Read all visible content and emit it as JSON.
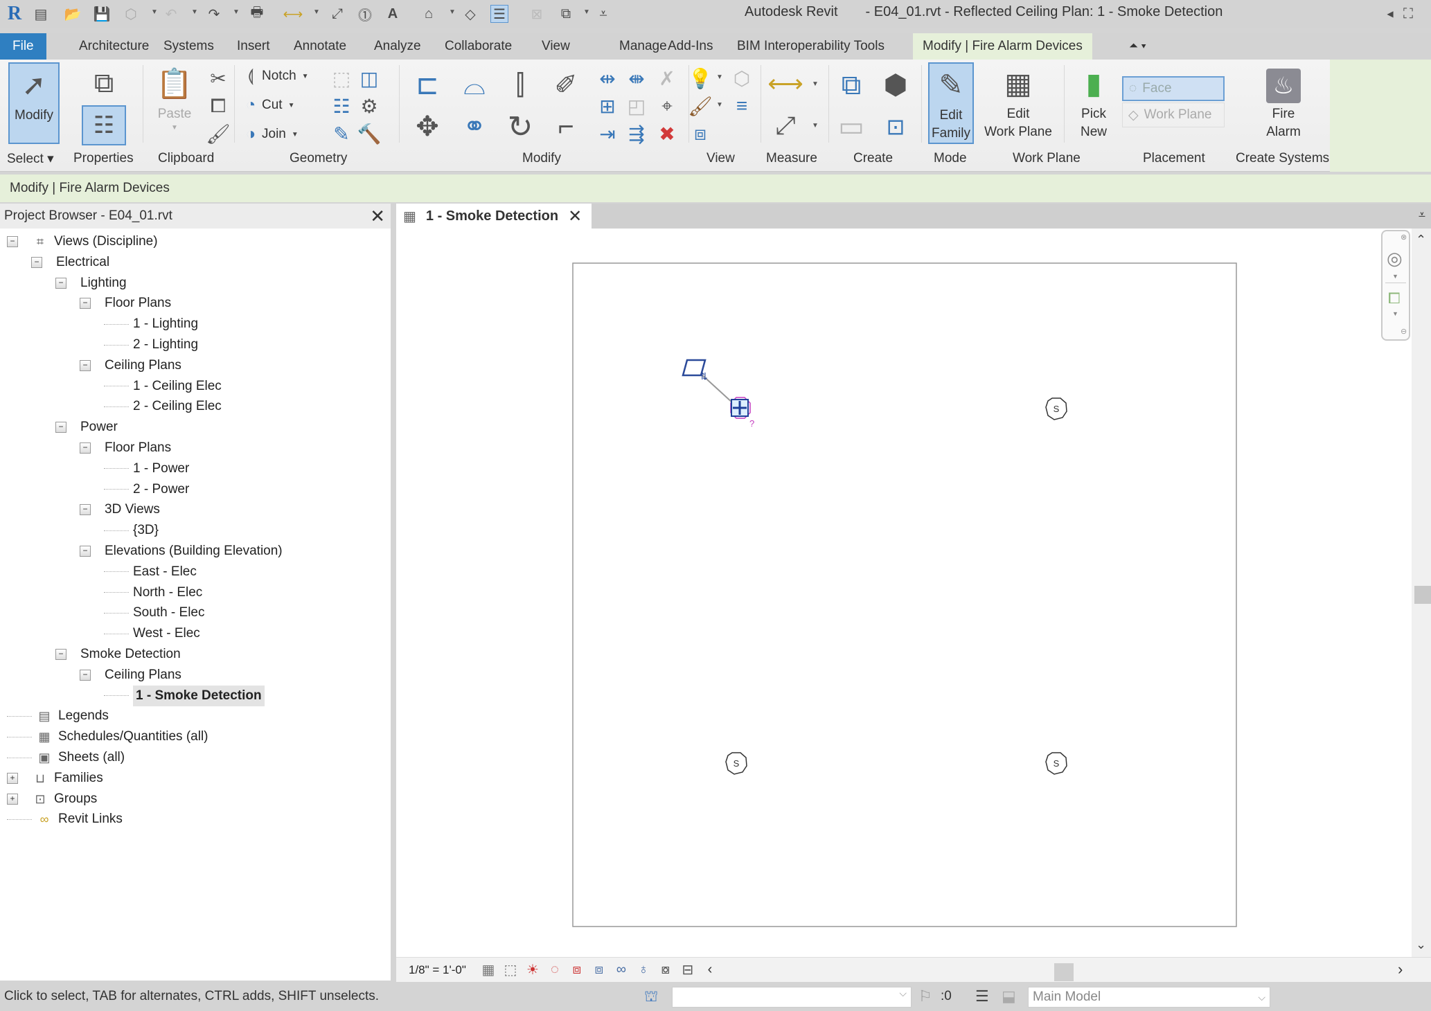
{
  "title_bar": {
    "app_name": "Autodesk Revit",
    "document_title": "- E04_01.rvt - Reflected Ceiling Plan: 1 - Smoke Detection",
    "quick_access_icons": [
      "revit-logo",
      "recent-files",
      "open",
      "save",
      "sync",
      "undo",
      "redo",
      "print",
      "measure",
      "aligned-dimension",
      "tag",
      "text",
      "3d-view",
      "section",
      "thin-lines",
      "close-hidden",
      "switch-windows",
      "customize"
    ]
  },
  "ribbon_tabs": [
    {
      "label": "File"
    },
    {
      "label": "Architecture"
    },
    {
      "label": "Systems"
    },
    {
      "label": "Insert"
    },
    {
      "label": "Annotate"
    },
    {
      "label": "Analyze"
    },
    {
      "label": "Collaborate"
    },
    {
      "label": "View"
    },
    {
      "label": "Manage"
    },
    {
      "label": "Add-Ins"
    },
    {
      "label": "BIM Interoperability Tools"
    },
    {
      "label": "Modify | Fire Alarm Devices",
      "active": true
    }
  ],
  "ribbon": {
    "select": {
      "modify_label": "Modify",
      "panel_label": "Select"
    },
    "properties": {
      "panel_label": "Properties"
    },
    "clipboard": {
      "paste_label": "Paste",
      "panel_label": "Clipboard"
    },
    "geometry": {
      "notch_label": "Notch",
      "cut_label": "Cut",
      "join_label": "Join",
      "panel_label": "Geometry"
    },
    "modify": {
      "panel_label": "Modify"
    },
    "view": {
      "panel_label": "View"
    },
    "measure": {
      "panel_label": "Measure"
    },
    "create": {
      "panel_label": "Create"
    },
    "mode": {
      "edit_family_label_1": "Edit",
      "edit_family_label_2": "Family",
      "panel_label": "Mode"
    },
    "work_plane": {
      "edit_wp_label_1": "Edit",
      "edit_wp_label_2": "Work Plane",
      "panel_label": "Work Plane"
    },
    "placement": {
      "pick_new_label_1": "Pick",
      "pick_new_label_2": "New",
      "face_label": "Face",
      "work_plane_label": "Work Plane",
      "panel_label": "Placement"
    },
    "create_systems": {
      "fire_alarm_label_1": "Fire",
      "fire_alarm_label_2": "Alarm",
      "panel_label": "Create Systems"
    }
  },
  "options_bar": {
    "context_label": "Modify | Fire Alarm Devices"
  },
  "project_browser": {
    "title": "Project Browser - E04_01.rvt",
    "tree": [
      {
        "label": "Views (Discipline)",
        "level": 0,
        "toggle": "-",
        "icon": "views"
      },
      {
        "label": "Electrical",
        "level": 1,
        "toggle": "-"
      },
      {
        "label": "Lighting",
        "level": 2,
        "toggle": "-"
      },
      {
        "label": "Floor Plans",
        "level": 3,
        "toggle": "-"
      },
      {
        "label": "1 - Lighting",
        "level": 4
      },
      {
        "label": "2 - Lighting",
        "level": 4
      },
      {
        "label": "Ceiling Plans",
        "level": 3,
        "toggle": "-"
      },
      {
        "label": "1 - Ceiling Elec",
        "level": 4
      },
      {
        "label": "2 - Ceiling Elec",
        "level": 4
      },
      {
        "label": "Power",
        "level": 2,
        "toggle": "-"
      },
      {
        "label": "Floor Plans",
        "level": 3,
        "toggle": "-"
      },
      {
        "label": "1 - Power",
        "level": 4
      },
      {
        "label": "2 - Power",
        "level": 4
      },
      {
        "label": "3D Views",
        "level": 3,
        "toggle": "-"
      },
      {
        "label": "{3D}",
        "level": 4
      },
      {
        "label": "Elevations (Building Elevation)",
        "level": 3,
        "toggle": "-"
      },
      {
        "label": "East - Elec",
        "level": 4
      },
      {
        "label": "North - Elec",
        "level": 4
      },
      {
        "label": "South - Elec",
        "level": 4
      },
      {
        "label": "West - Elec",
        "level": 4
      },
      {
        "label": "Smoke Detection",
        "level": 2,
        "toggle": "-"
      },
      {
        "label": "Ceiling Plans",
        "level": 3,
        "toggle": "-"
      },
      {
        "label": "1 - Smoke Detection",
        "level": 4,
        "selected": true
      },
      {
        "label": "Legends",
        "level": 0,
        "icon": "legends"
      },
      {
        "label": "Schedules/Quantities (all)",
        "level": 0,
        "icon": "schedules"
      },
      {
        "label": "Sheets (all)",
        "level": 0,
        "icon": "sheets"
      },
      {
        "label": "Families",
        "level": 0,
        "toggle": "+",
        "icon": "families"
      },
      {
        "label": "Groups",
        "level": 0,
        "toggle": "+",
        "icon": "groups"
      },
      {
        "label": "Revit Links",
        "level": 0,
        "icon": "revit-links"
      }
    ]
  },
  "view": {
    "tab_label": "1 - Smoke Detection",
    "detector_symbol": "S",
    "selected_device_tag": "?",
    "scale": "1/8\" = 1'-0\""
  },
  "status_bar": {
    "hint": "Click to select, TAB for alternates, CTRL adds, SHIFT unselects.",
    "workset_value": "",
    "editing_requests": ":0",
    "design_option": "Main Model"
  },
  "colors": {
    "file_tab": "#2f7fc1",
    "context_tab": "#e6f0da",
    "selection_blue": "#bcd6ef",
    "selected_device": "#1f3f9a",
    "selection_magenta": "#c43bbf"
  }
}
